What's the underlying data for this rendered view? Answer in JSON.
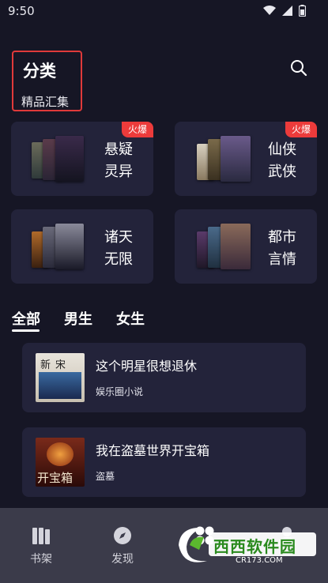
{
  "status_bar": {
    "time": "9:50"
  },
  "header": {
    "title": "分类",
    "subtitle": "精品汇集"
  },
  "categories": [
    {
      "line1": "悬疑",
      "line2": "灵异",
      "badge": "火爆"
    },
    {
      "line1": "仙侠",
      "line2": "武侠",
      "badge": "火爆"
    },
    {
      "line1": "诸天",
      "line2": "无限"
    },
    {
      "line1": "都市",
      "line2": "言情"
    }
  ],
  "tabs": [
    {
      "label": "全部"
    },
    {
      "label": "男生"
    },
    {
      "label": "女生"
    }
  ],
  "books": [
    {
      "title": "这个明星很想退休",
      "tag": "娱乐圈小说",
      "cover_text": "新宋"
    },
    {
      "title": "我在盗墓世界开宝箱",
      "tag": "盗墓",
      "cover_text": "开宝箱"
    }
  ],
  "bottom_nav": [
    {
      "label": "书架",
      "icon": "bookshelf-icon"
    },
    {
      "label": "发现",
      "icon": "compass-icon"
    },
    {
      "label": "",
      "icon": "category-grid-icon"
    },
    {
      "label": "",
      "icon": "user-icon"
    }
  ],
  "watermark": {
    "text": "西西软件园",
    "sub": "CR173.COM"
  },
  "colors": {
    "background": "#161625",
    "card": "#23233a",
    "accent_red": "#ec3b3b",
    "nav_bg": "#3b3b4a"
  }
}
